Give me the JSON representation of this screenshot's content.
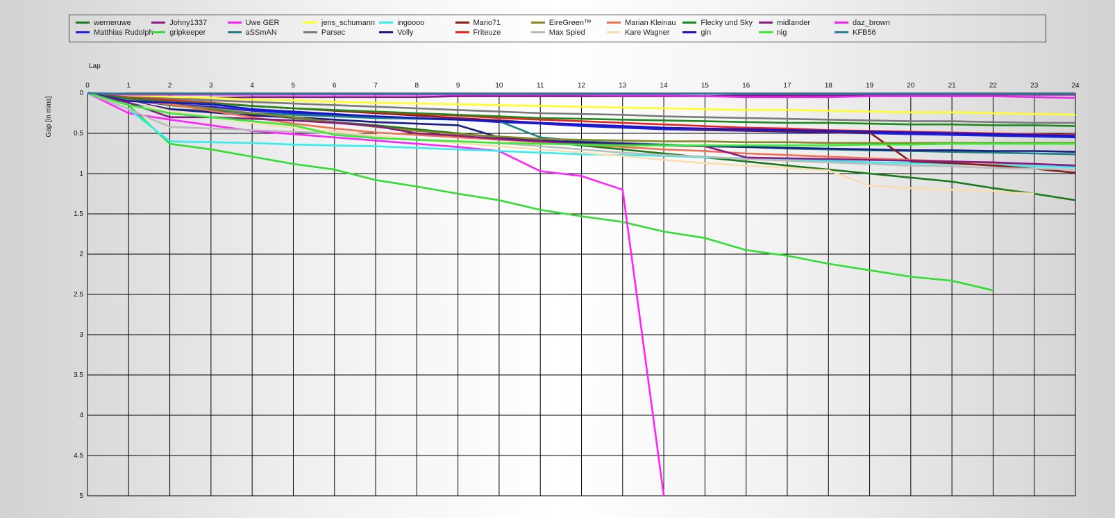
{
  "chart_data": {
    "type": "line",
    "xlabel": "Lap",
    "ylabel": "Gap [in mins]",
    "xlim": [
      0,
      24
    ],
    "ylim": [
      0,
      5
    ],
    "y_inverted": true,
    "x_ticks": [
      "0",
      "1",
      "2",
      "3",
      "4",
      "5",
      "6",
      "7",
      "8",
      "9",
      "10",
      "11",
      "12",
      "13",
      "14",
      "15",
      "16",
      "17",
      "18",
      "19",
      "20",
      "21",
      "22",
      "23",
      "24"
    ],
    "y_ticks": [
      "0",
      "0.5",
      "1",
      "1.5",
      "2",
      "2.5",
      "3",
      "3.5",
      "4",
      "4.5",
      "5"
    ],
    "grid": true,
    "legend_position": "top",
    "x": [
      0,
      1,
      2,
      3,
      4,
      5,
      6,
      7,
      8,
      9,
      10,
      11,
      12,
      13,
      14,
      15,
      16,
      17,
      18,
      19,
      20,
      21,
      22,
      23,
      24
    ],
    "series": [
      {
        "name": "werneruwe",
        "color": "#1a7a1a",
        "values": [
          0,
          0.08,
          0.15,
          0.2,
          0.26,
          0.31,
          0.36,
          0.4,
          0.45,
          0.5,
          0.55,
          0.6,
          0.65,
          0.7,
          0.75,
          0.8,
          0.85,
          0.9,
          0.95,
          1.0,
          1.05,
          1.1,
          1.18,
          1.25,
          1.33
        ]
      },
      {
        "name": "Matthias Rudolph",
        "color": "#1f1fe0",
        "values": [
          0,
          0.1,
          0.14,
          0.17,
          0.22,
          0.25,
          0.27,
          0.29,
          0.31,
          0.33,
          0.36,
          0.38,
          0.41,
          0.43,
          0.45,
          0.46,
          0.47,
          0.48,
          0.49,
          0.5,
          0.51,
          0.52,
          0.53,
          0.54,
          0.55
        ]
      },
      {
        "name": "Johny1337",
        "color": "#8b1a8b",
        "values": [
          0,
          0.05,
          0.06,
          0.06,
          0.05,
          0.05,
          0.05,
          0.05,
          0.05,
          0.04,
          0.04,
          0.04,
          0.04,
          0.04,
          0.04,
          0.04,
          0.03,
          0.03,
          0.03,
          0.03,
          0.03,
          0.02,
          0.02,
          0.02,
          0.02
        ]
      },
      {
        "name": "gripkeeper",
        "color": "#33dd33",
        "values": [
          0,
          0.15,
          0.63,
          0.7,
          0.79,
          0.88,
          0.95,
          1.08,
          1.16,
          1.25,
          1.33,
          1.45,
          1.53,
          1.6,
          1.72,
          1.8,
          1.95,
          2.02,
          2.12,
          2.2,
          2.28,
          2.33,
          2.45
        ]
      },
      {
        "name": "Uwe GER",
        "color": "#ff22ff",
        "values": [
          0,
          0.25,
          0.33,
          0.4,
          0.47,
          0.51,
          0.55,
          0.59,
          0.63,
          0.67,
          0.72,
          0.97,
          1.03,
          1.2,
          5.0
        ]
      },
      {
        "name": "aSSmAN",
        "color": "#168080",
        "values": [
          0,
          0.12,
          0.2,
          0.22,
          0.25,
          0.27,
          0.29,
          0.31,
          0.32,
          0.33,
          0.35,
          0.55,
          0.6,
          0.62,
          0.64,
          0.66,
          0.67,
          0.69,
          0.7,
          0.71,
          0.72,
          0.73,
          0.74,
          0.75,
          0.76
        ]
      },
      {
        "name": "jens_schumann",
        "color": "#ffff22",
        "values": [
          0,
          0.03,
          0.05,
          0.06,
          0.08,
          0.09,
          0.11,
          0.12,
          0.13,
          0.14,
          0.15,
          0.16,
          0.17,
          0.18,
          0.19,
          0.2,
          0.21,
          0.21,
          0.22,
          0.23,
          0.24,
          0.24,
          0.25,
          0.26,
          0.27
        ]
      },
      {
        "name": "Parsec",
        "color": "#7a7a7a",
        "values": [
          0,
          0.05,
          0.07,
          0.09,
          0.11,
          0.13,
          0.15,
          0.17,
          0.19,
          0.21,
          0.23,
          0.25,
          0.26,
          0.27,
          0.29,
          0.3,
          0.31,
          0.32,
          0.33,
          0.34,
          0.35,
          0.35,
          0.36,
          0.37,
          0.37
        ]
      },
      {
        "name": "ingoooo",
        "color": "#33eeee",
        "values": [
          0,
          0.2,
          0.6,
          0.61,
          0.62,
          0.64,
          0.65,
          0.66,
          0.68,
          0.7,
          0.72,
          0.74,
          0.76,
          0.77,
          0.78,
          0.8,
          0.81,
          0.82,
          0.84,
          0.86,
          0.87,
          0.88,
          0.89,
          0.91,
          0.92
        ]
      },
      {
        "name": "Volly",
        "color": "#1a1a88",
        "values": [
          0,
          0.1,
          0.2,
          0.24,
          0.28,
          0.3,
          0.33,
          0.36,
          0.38,
          0.4,
          0.55,
          0.59,
          0.61,
          0.63,
          0.65,
          0.66,
          0.67,
          0.68,
          0.69,
          0.7,
          0.71,
          0.71,
          0.72,
          0.72,
          0.73
        ]
      },
      {
        "name": "Mario71",
        "color": "#8b1a1a",
        "values": [
          0,
          0.07,
          0.1,
          0.13,
          0.16,
          0.19,
          0.22,
          0.25,
          0.28,
          0.31,
          0.34,
          0.37,
          0.39,
          0.41,
          0.43,
          0.45,
          0.46,
          0.47,
          0.48,
          0.49,
          0.85,
          0.87,
          0.9,
          0.94,
          0.99
        ]
      },
      {
        "name": "Friteuze",
        "color": "#ee2020",
        "values": [
          0,
          0.06,
          0.09,
          0.12,
          0.16,
          0.19,
          0.21,
          0.24,
          0.26,
          0.28,
          0.31,
          0.33,
          0.35,
          0.37,
          0.39,
          0.41,
          0.43,
          0.44,
          0.46,
          0.47,
          0.48,
          0.49,
          0.5,
          0.51,
          0.52
        ]
      },
      {
        "name": "EireGreen™",
        "color": "#888822",
        "values": [
          0,
          0.08,
          0.14,
          0.19,
          0.25,
          0.3,
          0.36,
          0.42,
          0.47,
          0.51,
          0.54,
          0.57,
          0.58,
          0.59,
          0.6,
          0.6,
          0.61,
          0.61,
          0.62,
          0.62,
          0.62,
          0.62,
          0.62,
          0.62,
          0.62
        ]
      },
      {
        "name": "Max Spied",
        "color": "#bbbbbb",
        "values": [
          0,
          0.2,
          0.42,
          0.44,
          0.46,
          0.48,
          0.5,
          0.55,
          0.58,
          0.6,
          0.62,
          0.66,
          0.7,
          0.74,
          0.77,
          0.79,
          0.82,
          0.84,
          0.86,
          0.88,
          0.9,
          0.91,
          0.93,
          0.94,
          0.95
        ]
      },
      {
        "name": "Marian Kleinau",
        "color": "#f07050",
        "values": [
          0,
          0.09,
          0.14,
          0.22,
          0.3,
          0.38,
          0.44,
          0.49,
          0.52,
          0.55,
          0.58,
          0.61,
          0.64,
          0.67,
          0.7,
          0.72,
          0.75,
          0.77,
          0.79,
          0.81,
          0.83,
          0.85,
          0.87,
          0.88,
          0.9
        ]
      },
      {
        "name": "Kare Wagner",
        "color": "#f8ddb0",
        "values": [
          0,
          0.1,
          0.22,
          0.3,
          0.37,
          0.43,
          0.48,
          0.53,
          0.58,
          0.62,
          0.66,
          0.7,
          0.74,
          0.78,
          0.83,
          0.87,
          0.9,
          0.93,
          0.96,
          1.15,
          1.18,
          1.2,
          1.22,
          1.25
        ]
      },
      {
        "name": "Flecky und Sky",
        "color": "#1a8a1a",
        "values": [
          0,
          0.07,
          0.11,
          0.13,
          0.16,
          0.19,
          0.21,
          0.23,
          0.25,
          0.27,
          0.29,
          0.31,
          0.32,
          0.33,
          0.34,
          0.35,
          0.36,
          0.37,
          0.37,
          0.38,
          0.39,
          0.39,
          0.4,
          0.4,
          0.41
        ]
      },
      {
        "name": "gin",
        "color": "#1515cc",
        "values": [
          0,
          0.1,
          0.12,
          0.14,
          0.2,
          0.23,
          0.26,
          0.29,
          0.31,
          0.33,
          0.35,
          0.37,
          0.39,
          0.41,
          0.43,
          0.44,
          0.45,
          0.46,
          0.47,
          0.48,
          0.49,
          0.5,
          0.51,
          0.52,
          0.53
        ]
      },
      {
        "name": "midlander",
        "color": "#881a88",
        "values": [
          0,
          0.12,
          0.3,
          0.3,
          0.32,
          0.34,
          0.37,
          0.41,
          0.5,
          0.53,
          0.57,
          0.6,
          0.63,
          0.64,
          0.65,
          0.66,
          0.8,
          0.81,
          0.82,
          0.83,
          0.84,
          0.85,
          0.86,
          0.88,
          0.9
        ]
      },
      {
        "name": "nig",
        "color": "#33ee33",
        "values": [
          0,
          0.15,
          0.25,
          0.3,
          0.35,
          0.4,
          0.52,
          0.56,
          0.58,
          0.6,
          0.62,
          0.63,
          0.64,
          0.65,
          0.65,
          0.65,
          0.65,
          0.65,
          0.65,
          0.64,
          0.64,
          0.63,
          0.63,
          0.63,
          0.63
        ]
      },
      {
        "name": "daz_brown",
        "color": "#ee22ee",
        "values": [
          0,
          0.02,
          0.02,
          0.02,
          0.02,
          0.02,
          0.02,
          0.02,
          0.02,
          0.02,
          0.02,
          0.02,
          0.02,
          0.03,
          0.03,
          0.04,
          0.05,
          0.05,
          0.05,
          0.04,
          0.04,
          0.04,
          0.04,
          0.05,
          0.06
        ]
      },
      {
        "name": "KFB56",
        "color": "#2a7a9a",
        "values": [
          0,
          0.01,
          0.01,
          0.01,
          0.01,
          0.01,
          0.01,
          0.01,
          0.01,
          0.01,
          0.01,
          0.01,
          0.01,
          0.01,
          0.01,
          0.01,
          0.01,
          0.01,
          0.01,
          0.01,
          0.01,
          0.01,
          0.01,
          0.01,
          0.01
        ]
      }
    ]
  }
}
